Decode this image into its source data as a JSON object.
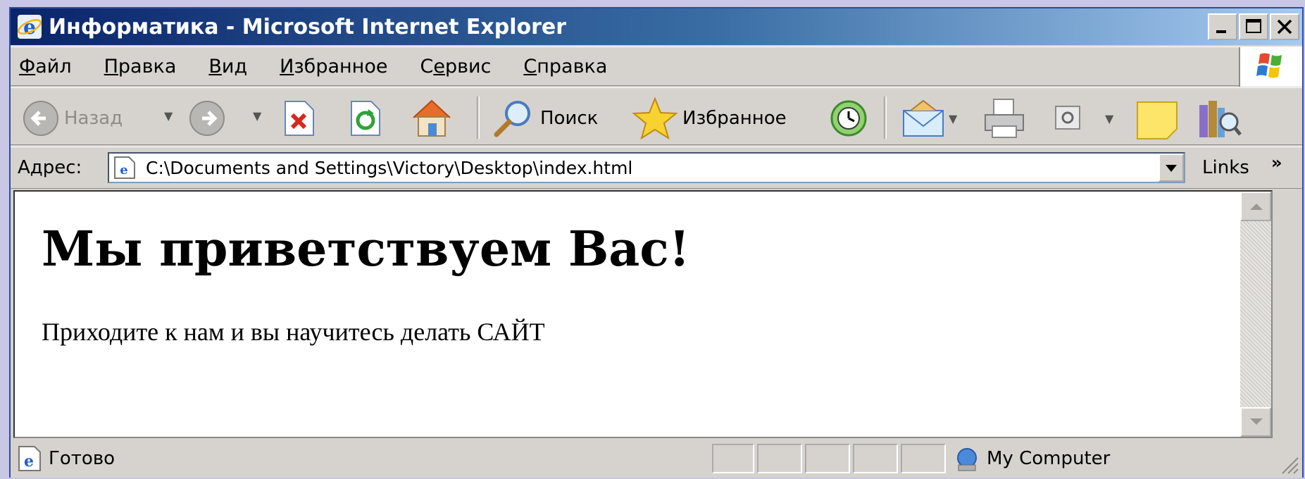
{
  "window": {
    "title": "Информатика - Microsoft Internet Explorer",
    "icons": [
      "ie-icon",
      "minimize-icon",
      "maximize-icon",
      "close-icon"
    ]
  },
  "menubar": {
    "items": [
      {
        "first": "Ф",
        "rest": "айл"
      },
      {
        "first": "П",
        "rest": "равка"
      },
      {
        "first": "В",
        "rest": "ид"
      },
      {
        "first": "И",
        "rest": "збранное"
      },
      {
        "first": "С",
        "rest": "ервис",
        "pre": "С",
        "under": "е",
        "post": "рвис"
      },
      {
        "first": "С",
        "rest": "правка"
      }
    ]
  },
  "toolbar": {
    "back_label": "Назад",
    "search_label": "Поиск",
    "favorites_label": "Избранное"
  },
  "address": {
    "label": "Адрес:",
    "value": "C:\\Documents and Settings\\Victory\\Desktop\\index.html",
    "links_label": "Links",
    "more": "»"
  },
  "page": {
    "heading": "Мы приветствуем Вас!",
    "text": "Приходите к нам и вы научитесь делать САЙТ"
  },
  "status": {
    "text": "Готово",
    "zone": "My Computer"
  },
  "colors": {
    "titlebar_start": "#0a246a",
    "titlebar_end": "#a6caf0",
    "chrome": "#d6d3ce",
    "desktop": "#c9c7e6"
  }
}
